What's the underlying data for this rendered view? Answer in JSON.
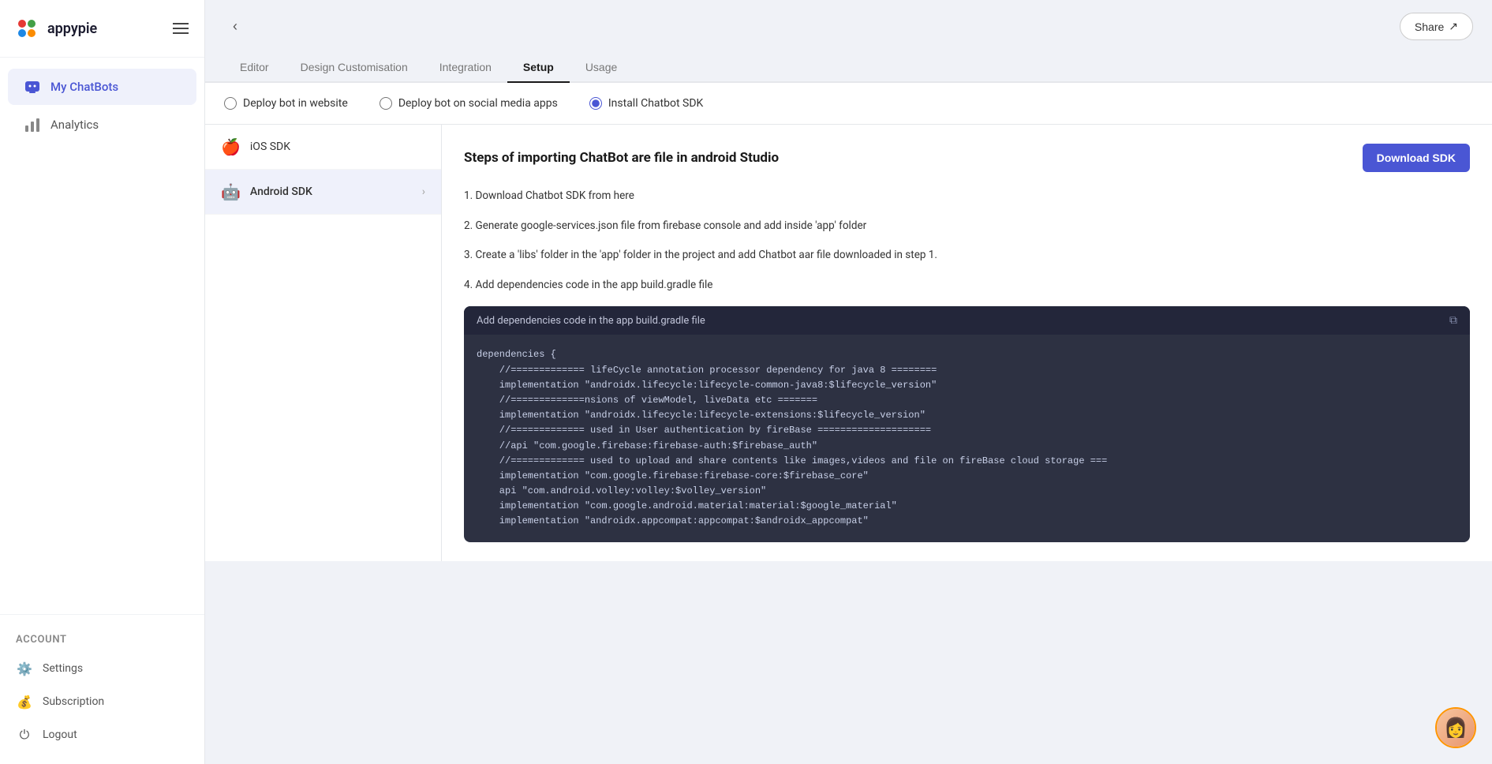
{
  "app": {
    "name": "appypie"
  },
  "sidebar": {
    "nav_items": [
      {
        "id": "chatbots",
        "label": "My ChatBots",
        "active": true
      },
      {
        "id": "analytics",
        "label": "Analytics",
        "active": false
      }
    ],
    "account_label": "Account",
    "footer_items": [
      {
        "id": "settings",
        "label": "Settings"
      },
      {
        "id": "subscription",
        "label": "Subscription"
      },
      {
        "id": "logout",
        "label": "Logout"
      }
    ]
  },
  "header": {
    "back_label": "<",
    "share_label": "Share"
  },
  "tabs": [
    {
      "id": "editor",
      "label": "Editor",
      "active": false
    },
    {
      "id": "design",
      "label": "Design Customisation",
      "active": false
    },
    {
      "id": "integration",
      "label": "Integration",
      "active": false
    },
    {
      "id": "setup",
      "label": "Setup",
      "active": true
    },
    {
      "id": "usage",
      "label": "Usage",
      "active": false
    }
  ],
  "deploy_options": [
    {
      "id": "website",
      "label": "Deploy bot in website",
      "checked": false
    },
    {
      "id": "social",
      "label": "Deploy bot on social media apps",
      "checked": false
    },
    {
      "id": "sdk",
      "label": "Install Chatbot SDK",
      "checked": true
    }
  ],
  "sdk": {
    "sidebar_items": [
      {
        "id": "ios",
        "label": "iOS SDK",
        "active": false,
        "icon": "🍎"
      },
      {
        "id": "android",
        "label": "Android SDK",
        "active": true,
        "icon": "🤖"
      }
    ],
    "content": {
      "title": "Steps of importing ChatBot are file in android Studio",
      "download_btn": "Download SDK",
      "steps": [
        "1. Download Chatbot SDK from here",
        "2. Generate google-services.json file from firebase console and add inside 'app' folder",
        "3. Create a 'libs' folder in the 'app' folder in the project and add Chatbot aar file downloaded in step 1.",
        "4. Add dependencies code in the app build.gradle file"
      ],
      "code_block": {
        "header": "Add dependencies code in the app build.gradle file",
        "code": "dependencies {\n    //============= lifeCycle annotation processor dependency for java 8 ========\n    implementation \"androidx.lifecycle:lifecycle-common-java8:$lifecycle_version\"\n    //=============nsions of viewModel, liveData etc =======\n    implementation \"androidx.lifecycle:lifecycle-extensions:$lifecycle_version\"\n    //============= used in User authentication by fireBase ====================\n    //api \"com.google.firebase:firebase-auth:$firebase_auth\"\n    //============= used to upload and share contents like images,videos and file on fireBase cloud storage ===\n    implementation \"com.google.firebase:firebase-core:$firebase_core\"\n    api \"com.android.volley:volley:$volley_version\"\n    implementation \"com.google.android.material:material:$google_material\"\n    implementation \"androidx.appcompat:appcompat:$androidx_appcompat\""
      }
    }
  }
}
